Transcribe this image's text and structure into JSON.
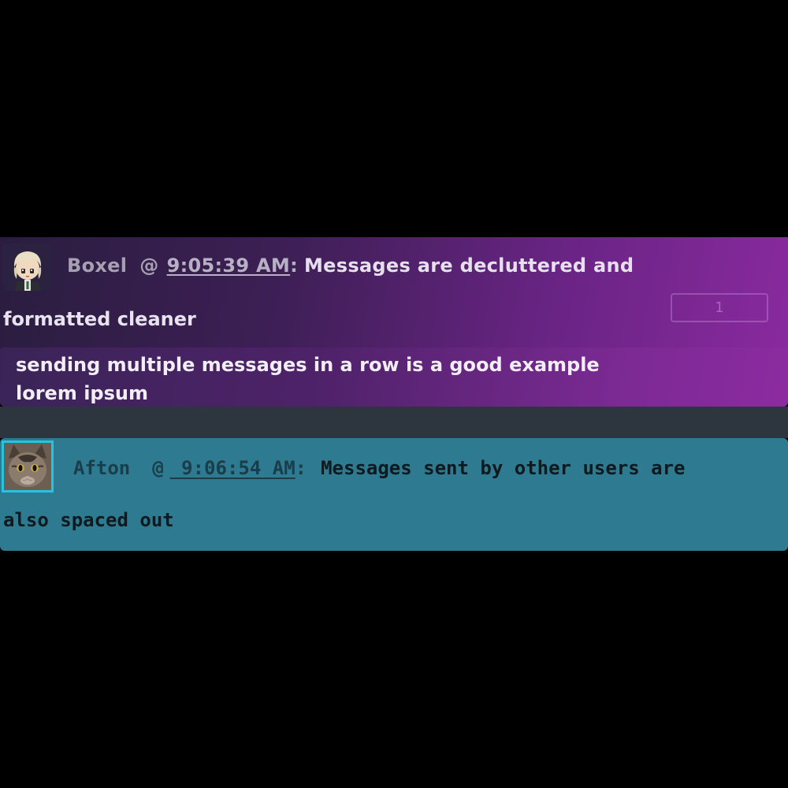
{
  "own_message": {
    "username": "Boxel",
    "at_symbol": "@",
    "timestamp": "9:05:39 AM",
    "separator": ":",
    "text_line1": "Messages are decluttered and",
    "text_line2": "formatted cleaner",
    "badge_count": "1",
    "followups": [
      "sending multiple messages in a row is a good example",
      "lorem ipsum"
    ]
  },
  "other_message": {
    "username": "Afton",
    "at_symbol": "@",
    "timestamp": " 9:06:54 AM",
    "separator": ":",
    "text_line1": "Messages sent by other users are",
    "text_line2": "also spaced out"
  },
  "colors": {
    "own_gradient_start": "#2a1d3f",
    "own_gradient_end": "#8a2a9f",
    "other_background": "#2e7a90",
    "avatar_border_other": "#22c6e3",
    "separator_bar": "#2d363e"
  },
  "icons": {
    "own_avatar": "chibi-character-avatar",
    "other_avatar": "cat-photo-avatar"
  }
}
